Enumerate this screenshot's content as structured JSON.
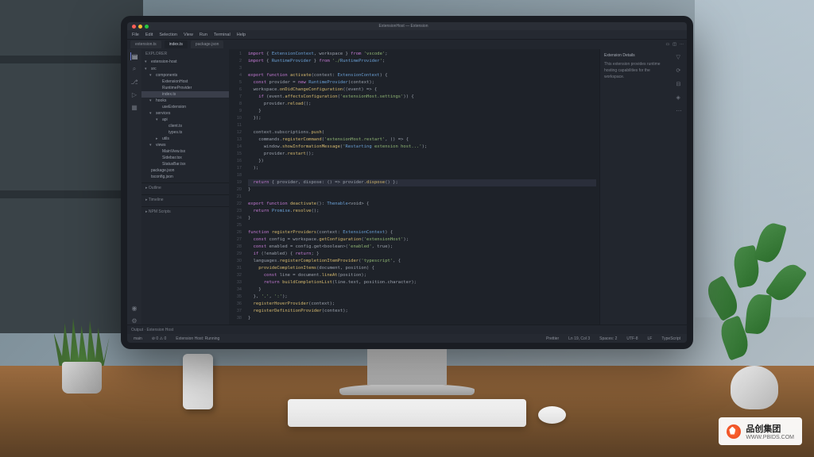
{
  "mac_title": "ExtensionHost — Extension",
  "menu": [
    "File",
    "Edit",
    "Selection",
    "View",
    "Run",
    "Terminal",
    "Help"
  ],
  "tabs": [
    {
      "label": "extension.ts",
      "active": false
    },
    {
      "label": "index.ts",
      "active": true
    },
    {
      "label": "package.json",
      "active": false
    }
  ],
  "top_right_icons": [
    "layout-icon",
    "split-icon",
    "more-icon"
  ],
  "activity_icons": [
    "files-icon",
    "search-icon",
    "git-icon",
    "debug-icon",
    "extensions-icon",
    "account-icon",
    "gear-icon"
  ],
  "sidebar": {
    "header": "Explorer",
    "project": "extension-host",
    "tree": [
      {
        "l": "src",
        "d": 0,
        "folder": true,
        "open": true
      },
      {
        "l": "components",
        "d": 1,
        "folder": true,
        "open": true
      },
      {
        "l": "ExtensionHost",
        "d": 2,
        "folder": false
      },
      {
        "l": "RuntimeProvider",
        "d": 2,
        "folder": false
      },
      {
        "l": "index.ts",
        "d": 2,
        "folder": false,
        "sel": true
      },
      {
        "l": "hooks",
        "d": 1,
        "folder": true,
        "open": true
      },
      {
        "l": "useExtension",
        "d": 2,
        "folder": false
      },
      {
        "l": "services",
        "d": 1,
        "folder": true,
        "open": true
      },
      {
        "l": "api",
        "d": 2,
        "folder": true,
        "open": true
      },
      {
        "l": "client.ts",
        "d": 3,
        "folder": false
      },
      {
        "l": "types.ts",
        "d": 3,
        "folder": false
      },
      {
        "l": "utils",
        "d": 2,
        "folder": true,
        "open": false
      },
      {
        "l": "views",
        "d": 1,
        "folder": true,
        "open": true
      },
      {
        "l": "MainView.tsx",
        "d": 2,
        "folder": false
      },
      {
        "l": "Sidebar.tsx",
        "d": 2,
        "folder": false
      },
      {
        "l": "StatusBar.tsx",
        "d": 2,
        "folder": false
      },
      {
        "l": "package.json",
        "d": 0,
        "folder": false
      },
      {
        "l": "tsconfig.json",
        "d": 0,
        "folder": false
      }
    ],
    "sections": [
      "Outline",
      "Timeline",
      "NPM Scripts"
    ]
  },
  "code_lines": [
    {
      "t": "import { ExtensionContext, workspace } from 'vscode';",
      "tok": [
        "kw",
        "var",
        "str"
      ]
    },
    {
      "t": "import { RuntimeProvider } from './RuntimeProvider';",
      "tok": [
        "kw",
        "var",
        "str"
      ]
    },
    {
      "t": "",
      "tok": []
    },
    {
      "t": "export function activate(context: ExtensionContext) {",
      "tok": [
        "kw",
        "fn",
        "var"
      ]
    },
    {
      "t": "  const provider = new RuntimeProvider(context);",
      "tok": [
        "kw",
        "var"
      ]
    },
    {
      "t": "  workspace.onDidChangeConfiguration((event) => {",
      "tok": [
        "var",
        "fn"
      ]
    },
    {
      "t": "    if (event.affectsConfiguration('extensionHost.settings')) {",
      "tok": [
        "kw",
        "fn",
        "str"
      ]
    },
    {
      "t": "      provider.reload();",
      "tok": [
        "var",
        "fn"
      ]
    },
    {
      "t": "    }",
      "tok": []
    },
    {
      "t": "  });",
      "tok": []
    },
    {
      "t": "",
      "tok": []
    },
    {
      "t": "  context.subscriptions.push(",
      "tok": [
        "var",
        "fn"
      ]
    },
    {
      "t": "    commands.registerCommand('extensionHost.restart', () => {",
      "tok": [
        "var",
        "fn",
        "str"
      ]
    },
    {
      "t": "      window.showInformationMessage('Restarting extension host...');",
      "tok": [
        "var",
        "fn",
        "str"
      ]
    },
    {
      "t": "      provider.restart();",
      "tok": [
        "var",
        "fn"
      ]
    },
    {
      "t": "    })",
      "tok": []
    },
    {
      "t": "  );",
      "tok": []
    },
    {
      "t": "",
      "tok": []
    },
    {
      "t": "  return { provider, dispose: () => provider.dispose() };",
      "tok": [
        "kw",
        "var"
      ],
      "hl": true
    },
    {
      "t": "}",
      "tok": []
    },
    {
      "t": "",
      "tok": []
    },
    {
      "t": "export function deactivate(): Thenable<void> {",
      "tok": [
        "kw",
        "fn",
        "var"
      ]
    },
    {
      "t": "  return Promise.resolve();",
      "tok": [
        "kw",
        "var",
        "fn"
      ]
    },
    {
      "t": "}",
      "tok": []
    },
    {
      "t": "",
      "tok": []
    },
    {
      "t": "function registerProviders(context: ExtensionContext) {",
      "tok": [
        "kw",
        "fn",
        "var"
      ]
    },
    {
      "t": "  const config = workspace.getConfiguration('extensionHost');",
      "tok": [
        "kw",
        "var",
        "fn",
        "str"
      ]
    },
    {
      "t": "  const enabled = config.get<boolean>('enabled', true);",
      "tok": [
        "kw",
        "var",
        "fn",
        "str"
      ]
    },
    {
      "t": "  if (!enabled) { return; }",
      "tok": [
        "kw"
      ]
    },
    {
      "t": "  languages.registerCompletionItemProvider('typescript', {",
      "tok": [
        "var",
        "fn",
        "str"
      ]
    },
    {
      "t": "    provideCompletionItems(document, position) {",
      "tok": [
        "fn",
        "var"
      ]
    },
    {
      "t": "      const line = document.lineAt(position);",
      "tok": [
        "kw",
        "var",
        "fn"
      ]
    },
    {
      "t": "      return buildCompletionList(line.text, position.character);",
      "tok": [
        "kw",
        "fn",
        "var"
      ]
    },
    {
      "t": "    }",
      "tok": []
    },
    {
      "t": "  }, '.', ':');",
      "tok": [
        "str"
      ]
    },
    {
      "t": "  registerHoverProvider(context);",
      "tok": [
        "fn",
        "var"
      ]
    },
    {
      "t": "  registerDefinitionProvider(context);",
      "tok": [
        "fn",
        "var"
      ]
    },
    {
      "t": "}",
      "tok": []
    }
  ],
  "right_panel": {
    "title": "Extension Details",
    "lines": [
      "This extension provides runtime",
      "hosting capabilities for the workspace."
    ],
    "icons": [
      "filter-icon",
      "refresh-icon",
      "collapse-icon",
      "pin-icon",
      "more-icon"
    ]
  },
  "terminal_header": "Output · Extension Host",
  "status": {
    "left": [
      "main",
      "⊘ 0 ⚠ 0",
      "Extension Host: Running"
    ],
    "right": [
      "Prettier",
      "Ln 19, Col 3",
      "Spaces: 2",
      "UTF-8",
      "LF",
      "TypeScript"
    ]
  },
  "watermark": {
    "brand": "品创集团",
    "url": "WWW.PBIDS.COM"
  }
}
